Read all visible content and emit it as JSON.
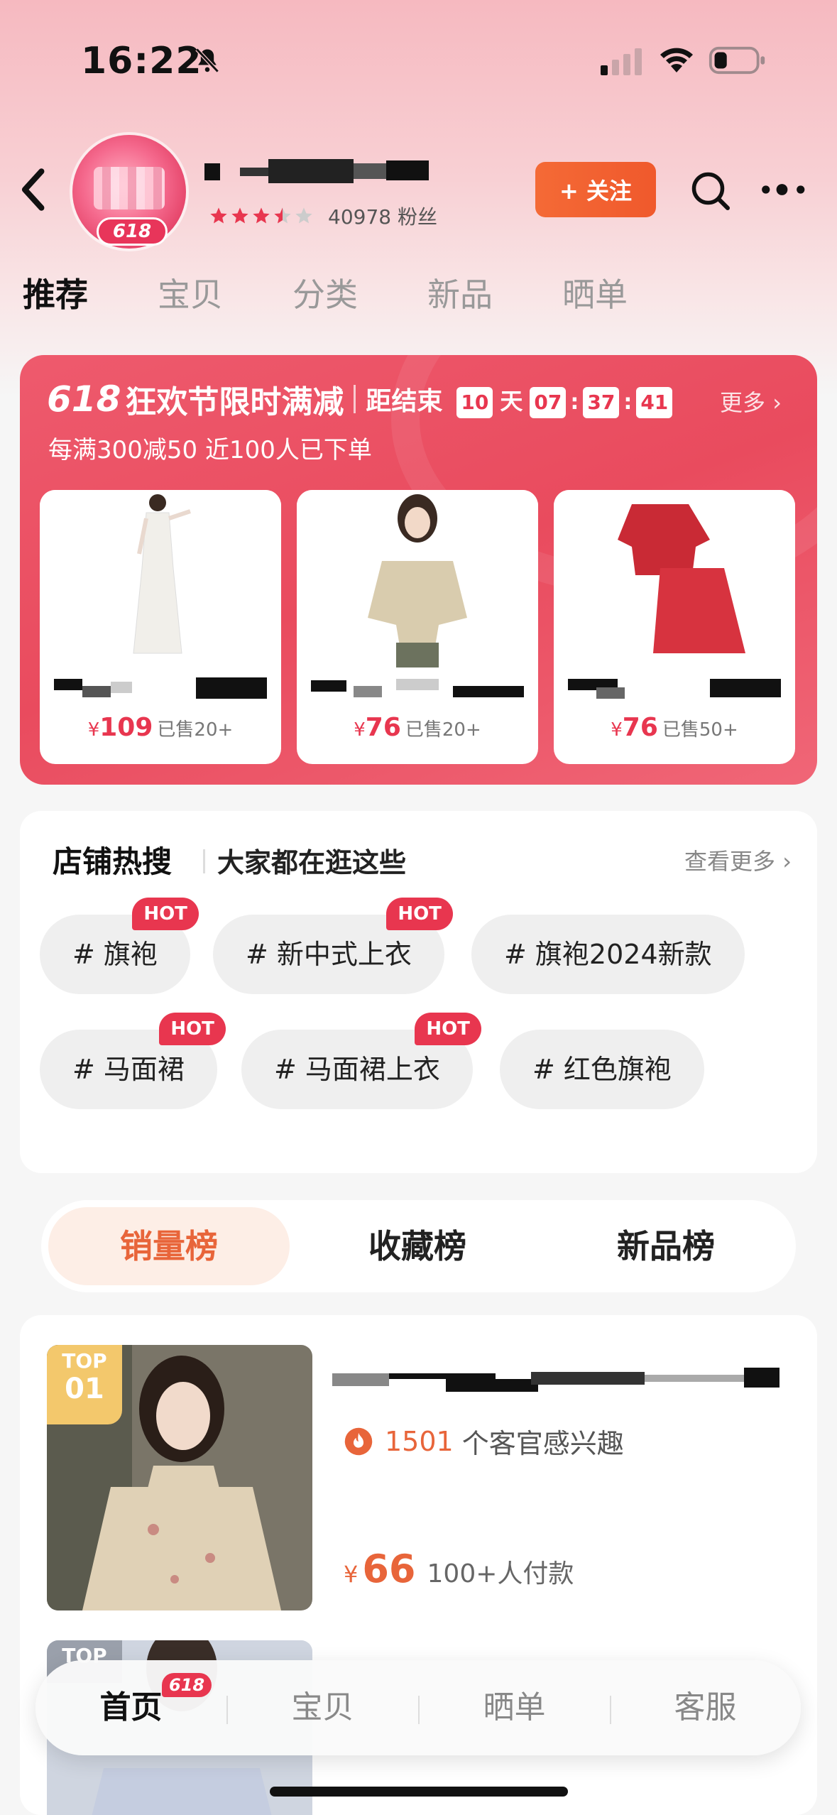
{
  "status_bar": {
    "time": "16:22"
  },
  "header": {
    "logo_badge": "618",
    "fans": "40978 粉丝",
    "follow_label": "+ 关注",
    "rating_stars": 3.5
  },
  "tabs": [
    "推荐",
    "宝贝",
    "分类",
    "新品",
    "晒单"
  ],
  "promo": {
    "logo_618": "618",
    "title": "狂欢节限时满减",
    "countdown_label": "距结束",
    "days": "10",
    "day_unit": "天",
    "hours": "07",
    "minutes": "37",
    "seconds": "41",
    "more": "更多 ›",
    "subtitle": "每满300减50 近100人已下单",
    "items": [
      {
        "price_symbol": "¥",
        "price": "109",
        "sold": "已售20+"
      },
      {
        "price_symbol": "¥",
        "price": "76",
        "sold": "已售20+"
      },
      {
        "price_symbol": "¥",
        "price": "76",
        "sold": "已售50+"
      }
    ]
  },
  "hot_search": {
    "title": "店铺热搜",
    "subtitle": "大家都在逛这些",
    "more": "查看更多 ›",
    "hot_label": "HOT",
    "chips": [
      "# 旗袍",
      "# 新中式上衣",
      "# 旗袍2024新款",
      "# 马面裙",
      "# 马面裙上衣",
      "# 红色旗袍"
    ]
  },
  "rank_tabs": [
    "销量榜",
    "收藏榜",
    "新品榜"
  ],
  "ranking": {
    "item1": {
      "top_label": "TOP",
      "rank": "01",
      "interest_count": "1501",
      "interest_text": "个客官感兴趣",
      "price_symbol": "¥",
      "price": "66",
      "paid": "100+人付款"
    },
    "item2": {
      "top_label": "TOP"
    }
  },
  "bottom_nav": {
    "badge": "618",
    "items": [
      "首页",
      "宝贝",
      "晒单",
      "客服"
    ]
  }
}
